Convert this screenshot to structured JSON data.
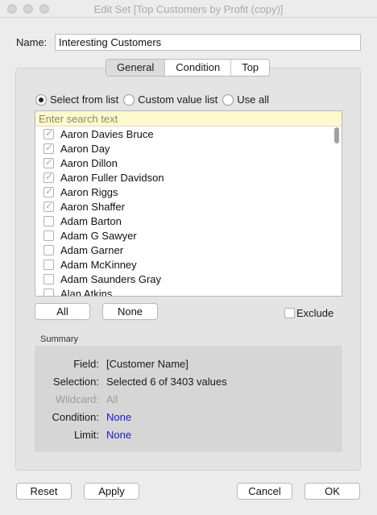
{
  "window": {
    "title": "Edit Set [Top Customers by Profit (copy)]"
  },
  "name": {
    "label": "Name:",
    "value": "Interesting Customers"
  },
  "tabs": [
    {
      "label": "General",
      "active": true
    },
    {
      "label": "Condition",
      "active": false
    },
    {
      "label": "Top",
      "active": false
    }
  ],
  "mode": {
    "options": [
      "Select from list",
      "Custom value list",
      "Use all"
    ],
    "selected": "Select from list"
  },
  "search": {
    "placeholder": "Enter search text"
  },
  "list": {
    "items": [
      {
        "label": "Aaron Davies Bruce",
        "checked": true
      },
      {
        "label": "Aaron Day",
        "checked": true
      },
      {
        "label": "Aaron Dillon",
        "checked": true
      },
      {
        "label": "Aaron Fuller Davidson",
        "checked": true
      },
      {
        "label": "Aaron Riggs",
        "checked": true
      },
      {
        "label": "Aaron Shaffer",
        "checked": true
      },
      {
        "label": "Adam Barton",
        "checked": false
      },
      {
        "label": "Adam G Sawyer",
        "checked": false
      },
      {
        "label": "Adam Garner",
        "checked": false
      },
      {
        "label": "Adam McKinney",
        "checked": false
      },
      {
        "label": "Adam Saunders Gray",
        "checked": false
      },
      {
        "label": "Alan Atkins",
        "checked": false
      }
    ]
  },
  "buttons": {
    "all": "All",
    "none": "None",
    "reset": "Reset",
    "apply": "Apply",
    "cancel": "Cancel",
    "ok": "OK"
  },
  "exclude": {
    "label": "Exclude",
    "checked": false
  },
  "summary": {
    "heading": "Summary",
    "field_key": "Field:",
    "field_val": "[Customer Name]",
    "selection_key": "Selection:",
    "selection_val": "Selected 6 of 3403 values",
    "wildcard_key": "Wildcard:",
    "wildcard_val": "All",
    "condition_key": "Condition:",
    "condition_val": "None",
    "limit_key": "Limit:",
    "limit_val": "None"
  },
  "colors": {
    "link_blue": "#1a1acf",
    "search_bg": "#fffacd",
    "panel_bg": "#e4e4e4"
  }
}
